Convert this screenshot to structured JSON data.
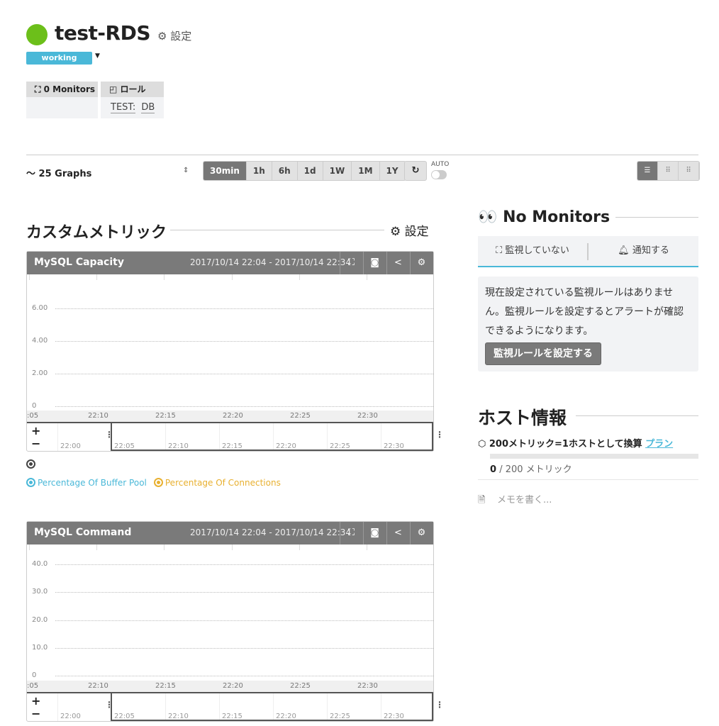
{
  "host": {
    "name": "test-RDS",
    "status_color": "#6cbf1a",
    "settings_label": "設定",
    "status": "working",
    "monitors_label": "0 Monitors",
    "roles_label": "ロール",
    "roles": [
      "TEST:",
      "DB"
    ]
  },
  "toolbar": {
    "graphs_label": "25 Graphs",
    "ranges": [
      "30min",
      "1h",
      "6h",
      "1d",
      "1W",
      "1M",
      "1Y"
    ],
    "active_range": "30min",
    "auto_label": "AUTO",
    "auto_on": false
  },
  "custom": {
    "title": "カスタムメトリック",
    "settings_label": "設定"
  },
  "graphs": [
    {
      "title": "MySQL Capacity",
      "range": "2017/10/14 22:04 - 2017/10/14 22:34",
      "yticks": [
        "6.00",
        "4.00",
        "2.00",
        "0"
      ],
      "xticks": [
        ":05",
        "22:10",
        "22:15",
        "22:20",
        "22:25",
        "22:30"
      ],
      "navticks": [
        "22:00",
        "22:05",
        "22:10",
        "22:15",
        "22:20",
        "22:25",
        "22:30"
      ],
      "legend": [
        {
          "name": "Percentage Of Buffer Pool",
          "color": "#4ab8d8"
        },
        {
          "name": "Percentage Of Connections",
          "color": "#e8b030"
        }
      ]
    },
    {
      "title": "MySQL Command",
      "range": "2017/10/14 22:04 - 2017/10/14 22:34",
      "yticks": [
        "40.0",
        "30.0",
        "20.0",
        "10.0",
        "0"
      ],
      "xticks": [
        ":05",
        "22:10",
        "22:15",
        "22:20",
        "22:25",
        "22:30"
      ],
      "navticks": [
        "22:00",
        "22:05",
        "22:10",
        "22:15",
        "22:20",
        "22:25",
        "22:30"
      ]
    }
  ],
  "monitors": {
    "title": "No Monitors",
    "tab_unmonitored": "監視していない",
    "tab_notify": "通知する",
    "message": "現在設定されている監視ルールはありません。監視ルールを設定するとアラートが確認できるようになります。",
    "button": "監視ルールを設定する"
  },
  "hostinfo": {
    "title": "ホスト情報",
    "note": "200メトリック=1ホストとして換算",
    "plan_link": "プラン",
    "used": "0",
    "total": "/ 200 メトリック",
    "usage_fraction": 0,
    "memo_placeholder": "メモを書く..."
  }
}
